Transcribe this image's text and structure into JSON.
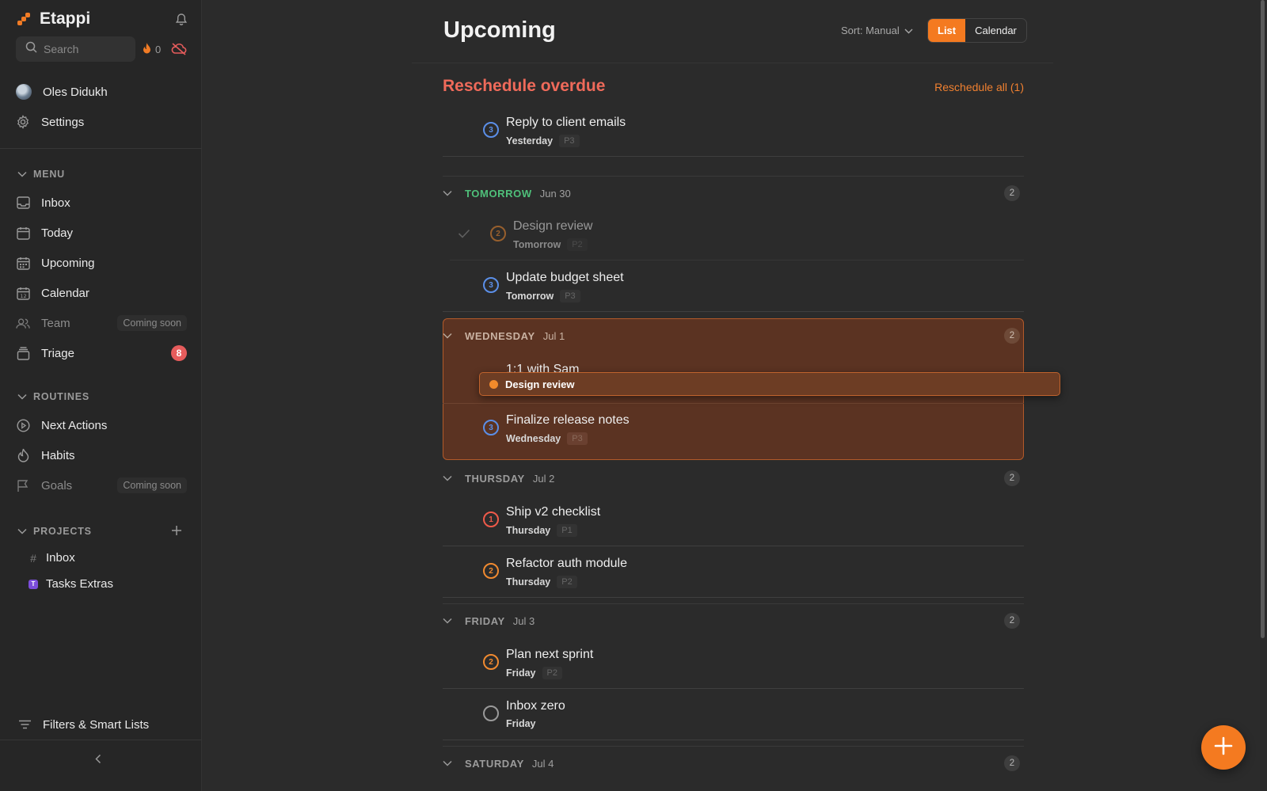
{
  "app": {
    "name": "Etappi",
    "streak_count": "0"
  },
  "search": {
    "placeholder": "Search"
  },
  "user": {
    "name": "Oles Didukh"
  },
  "top_links": {
    "settings": "Settings"
  },
  "sections": {
    "menu": "MENU",
    "routines": "ROUTINES",
    "projects": "PROJECTS"
  },
  "menu": [
    {
      "label": "Inbox",
      "icon": "inbox-icon"
    },
    {
      "label": "Today",
      "icon": "calendar-day-icon"
    },
    {
      "label": "Upcoming",
      "icon": "calendar-grid-icon"
    },
    {
      "label": "Calendar",
      "icon": "calendar-icon"
    },
    {
      "label": "Team",
      "icon": "team-icon",
      "tag": "Coming soon"
    },
    {
      "label": "Triage",
      "icon": "triage-icon",
      "badge": "8"
    }
  ],
  "routines": [
    {
      "label": "Next Actions",
      "icon": "play-circle-icon"
    },
    {
      "label": "Habits",
      "icon": "habit-icon"
    },
    {
      "label": "Goals",
      "icon": "flag-icon",
      "tag": "Coming soon"
    }
  ],
  "projects": [
    {
      "label": "Inbox",
      "icon": "hash-icon"
    },
    {
      "label": "Tasks Extras",
      "icon": "project-badge-icon",
      "badge_letter": "T"
    }
  ],
  "footer": {
    "filters": "Filters & Smart Lists"
  },
  "header": {
    "title": "Upcoming",
    "sort_label": "Sort: Manual",
    "view_list": "List",
    "view_calendar": "Calendar"
  },
  "overdue": {
    "title": "Reschedule overdue",
    "action": "Reschedule all (1)",
    "task": {
      "title": "Reply to client emails",
      "day": "Yesterday",
      "priority": "P3",
      "ring": "3"
    }
  },
  "groups": [
    {
      "name": "TOMORROW",
      "date": "Jun 30",
      "count": "2",
      "tasks": [
        {
          "title": "Design review",
          "day": "Tomorrow",
          "priority": "P2",
          "ring": "2"
        },
        {
          "title": "Update budget sheet",
          "day": "Tomorrow",
          "priority": "P3",
          "ring": "3"
        }
      ]
    },
    {
      "name": "WEDNESDAY",
      "date": "Jul 1",
      "count": "2",
      "tasks": [
        {
          "title": "1:1 with Sam",
          "day": "",
          "priority": "",
          "ring": ""
        },
        {
          "title": "Finalize release notes",
          "day": "Wednesday",
          "priority": "P3",
          "ring": "3"
        }
      ]
    },
    {
      "name": "THURSDAY",
      "date": "Jul 2",
      "count": "2",
      "tasks": [
        {
          "title": "Ship v2 checklist",
          "day": "Thursday",
          "priority": "P1",
          "ring": "1"
        },
        {
          "title": "Refactor auth module",
          "day": "Thursday",
          "priority": "P2",
          "ring": "2"
        }
      ]
    },
    {
      "name": "FRIDAY",
      "date": "Jul 3",
      "count": "2",
      "tasks": [
        {
          "title": "Plan next sprint",
          "day": "Friday",
          "priority": "P2",
          "ring": "2"
        },
        {
          "title": "Inbox zero",
          "day": "Friday",
          "priority": "",
          "ring": ""
        }
      ]
    },
    {
      "name": "SATURDAY",
      "date": "Jul 4",
      "count": "2",
      "tasks": []
    }
  ],
  "drag": {
    "label": "Design review"
  },
  "colors": {
    "accent": "#f47a20",
    "overdue": "#ef6a5a",
    "tomorrow": "#4fc07a",
    "p1": "#ef5a4a",
    "p2": "#f08a30",
    "p3": "#5b8fe8"
  }
}
